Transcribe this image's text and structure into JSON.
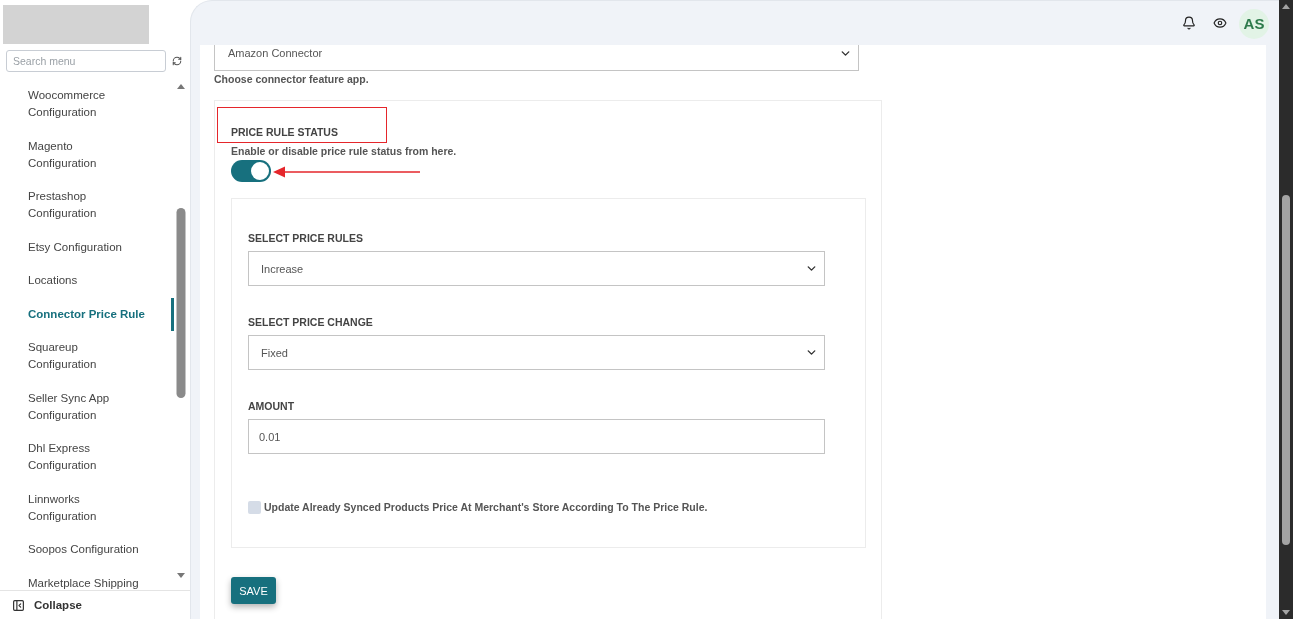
{
  "sidebar": {
    "search": {
      "placeholder": "Search menu"
    },
    "items": [
      {
        "label": "Woocommerce Configuration",
        "selected": false
      },
      {
        "label": "Magento Configuration",
        "selected": false
      },
      {
        "label": "Prestashop Configuration",
        "selected": false
      },
      {
        "label": "Etsy Configuration",
        "selected": false
      },
      {
        "label": "Locations",
        "selected": false
      },
      {
        "label": "Connector Price Rule",
        "selected": true
      },
      {
        "label": "Squareup Configuration",
        "selected": false
      },
      {
        "label": "Seller Sync App Configuration",
        "selected": false
      },
      {
        "label": "Dhl Express Configuration",
        "selected": false
      },
      {
        "label": "Linnworks Configuration",
        "selected": false
      },
      {
        "label": "Soopos Configuration",
        "selected": false
      },
      {
        "label": "Marketplace Shipping",
        "selected": false
      }
    ],
    "collapse": {
      "label": "Collapse"
    }
  },
  "header": {
    "avatar": {
      "initials": "AS"
    }
  },
  "connector": {
    "value": "Amazon Connector",
    "hint": "Choose connector feature app."
  },
  "price_rule": {
    "title": "PRICE RULE STATUS",
    "description": "Enable or disable price rule status from here.",
    "on": true,
    "title_highlighted": true,
    "toggle_pointer_arrow": true,
    "fields": [
      {
        "kind": "select",
        "label": "SELECT PRICE RULES",
        "value": "Increase"
      },
      {
        "kind": "select",
        "label": "SELECT PRICE CHANGE",
        "value": "Fixed"
      },
      {
        "kind": "input",
        "label": "AMOUNT",
        "value": "0.01"
      }
    ],
    "sync_option": {
      "label": "Update Already Synced Products Price At Merchant's Store According To The Price Rule.",
      "checked": false
    },
    "save_button": {
      "label": "SAVE"
    }
  }
}
